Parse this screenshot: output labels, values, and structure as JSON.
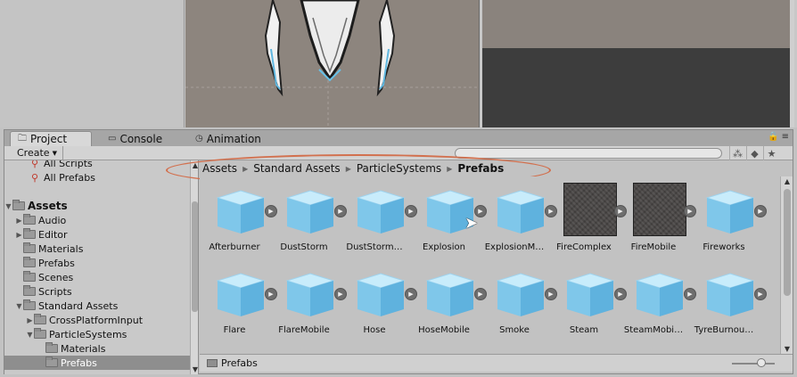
{
  "tabs": [
    {
      "label": "Project",
      "icon": "folder-icon",
      "active": true
    },
    {
      "label": "Console",
      "icon": "console-icon",
      "active": false
    },
    {
      "label": "Animation",
      "icon": "clock-icon",
      "active": false
    }
  ],
  "toolbar": {
    "create_label": "Create"
  },
  "tree": {
    "favorites": [
      "All Scripts",
      "All Prefabs"
    ],
    "items": [
      {
        "label": "Assets",
        "level": 0,
        "bold": true,
        "expanded": true
      },
      {
        "label": "Audio",
        "level": 1
      },
      {
        "label": "Editor",
        "level": 1
      },
      {
        "label": "Materials",
        "level": 1
      },
      {
        "label": "Prefabs",
        "level": 1
      },
      {
        "label": "Scenes",
        "level": 1
      },
      {
        "label": "Scripts",
        "level": 1
      },
      {
        "label": "Standard Assets",
        "level": 1,
        "expanded": true
      },
      {
        "label": "CrossPlatformInput",
        "level": 2
      },
      {
        "label": "ParticleSystems",
        "level": 2,
        "expanded": true
      },
      {
        "label": "Materials",
        "level": 3
      },
      {
        "label": "Prefabs",
        "level": 3,
        "selected": true
      }
    ]
  },
  "breadcrumb": [
    "Assets",
    "Standard Assets",
    "ParticleSystems",
    "Prefabs"
  ],
  "assets_row1": [
    {
      "label": "Afterburner",
      "thumb": "cube"
    },
    {
      "label": "DustStorm",
      "thumb": "cube"
    },
    {
      "label": "DustStorm…",
      "thumb": "cube"
    },
    {
      "label": "Explosion",
      "thumb": "cube"
    },
    {
      "label": "ExplosionM…",
      "thumb": "cube"
    },
    {
      "label": "FireComplex",
      "thumb": "texture"
    },
    {
      "label": "FireMobile",
      "thumb": "texture"
    },
    {
      "label": "Fireworks",
      "thumb": "cube"
    }
  ],
  "assets_row2": [
    {
      "label": "Flare",
      "thumb": "cube"
    },
    {
      "label": "FlareMobile",
      "thumb": "cube"
    },
    {
      "label": "Hose",
      "thumb": "cube"
    },
    {
      "label": "HoseMobile",
      "thumb": "cube"
    },
    {
      "label": "Smoke",
      "thumb": "cube"
    },
    {
      "label": "Steam",
      "thumb": "cube"
    },
    {
      "label": "SteamMobi…",
      "thumb": "cube"
    },
    {
      "label": "TyreBurnou…",
      "thumb": "cube"
    }
  ],
  "status": {
    "path": "Prefabs"
  },
  "colors": {
    "highlight": "#d2704e",
    "cube": "#7fc7ea",
    "selected_row": "#8e8e8e"
  }
}
